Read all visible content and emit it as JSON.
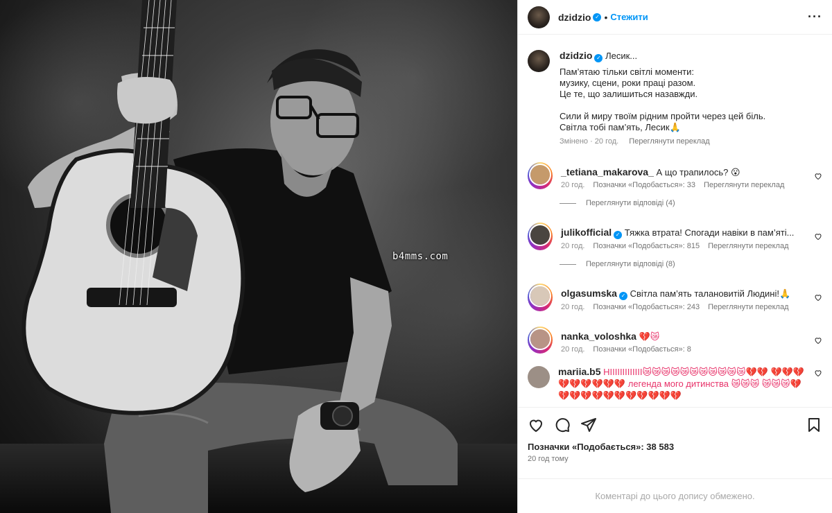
{
  "post": {
    "username": "dzidzio",
    "follow_label": "Стежити",
    "more_label": "···",
    "watermark": "b4mms.com",
    "caption": {
      "title": "Лесик...",
      "lines1": [
        "Пам’ятаю тільки світлі моменти:",
        "музику, сцени, роки праці разом.",
        "Це те, що залишиться назавжди."
      ],
      "lines2": [
        "Сили й миру твоїм рідним пройти через цей біль.",
        "Світла тобі пам’ять, Лесик🙏"
      ],
      "edited": "Змінено · 20 год.",
      "translate": "Переглянути переклад"
    },
    "comments": [
      {
        "user": "_tetiana_makarova_",
        "verified": false,
        "text": "А що трапилось? 😮",
        "time": "20 год.",
        "likes": "Позначки «Подобається»: 33",
        "translate": "Переглянути переклад",
        "replies": "Переглянути відповіді (4)",
        "avatar": "#c59a6b"
      },
      {
        "user": "julikofficial",
        "verified": true,
        "text": "Тяжка втрата! Спогади навіки в пам’яті...",
        "time": "20 год.",
        "likes": "Позначки «Подобається»: 815",
        "translate": "Переглянути переклад",
        "replies": "Переглянути відповіді (8)",
        "avatar": "#4a4540"
      },
      {
        "user": "olgasumska",
        "verified": true,
        "text": "Світла пам’ять талановитій Людині!🙏",
        "time": "20 год.",
        "likes": "Позначки «Подобається»: 243",
        "translate": "Переглянути переклад",
        "replies": "",
        "avatar": "#d8c8b8"
      },
      {
        "user": "nanka_voloshka",
        "verified": false,
        "text": "💔😿",
        "time": "20 год.",
        "likes": "Позначки «Подобається»: 8",
        "translate": "",
        "replies": "",
        "avatar": "#b89486"
      },
      {
        "user": "mariia.b5",
        "verified": false,
        "text": "НІІІІІІІІІІІІІ😿😿😿😿😿😿😿😿😿😿😿💔💔 💔💔💔💔💔💔💔💔💔 легенда мого дитинства 😿😿😿 😿😿😿💔💔💔💔💔💔💔💔💔💔💔💔",
        "time": "",
        "likes": "",
        "translate": "",
        "replies": "",
        "avatar": "#9c8f86"
      }
    ],
    "likes_total": "Позначки «Подобається»: 38 583",
    "posted": "20 год тому",
    "comments_closed": "Коментарі до цього допису обмежено."
  }
}
